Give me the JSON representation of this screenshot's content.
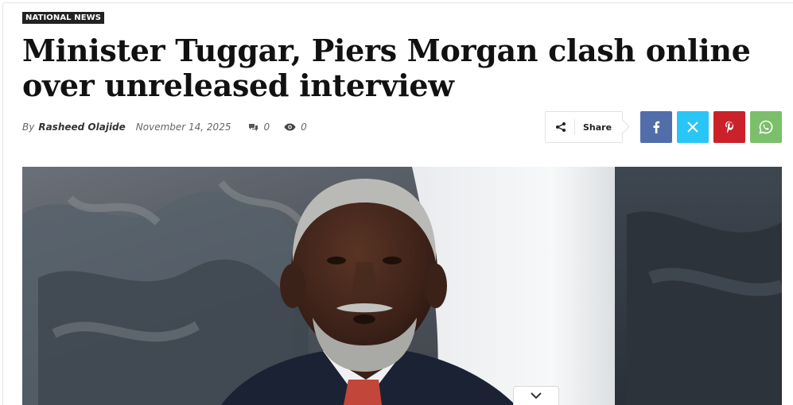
{
  "article": {
    "category": "NATIONAL NEWS",
    "headline": "Minister Tuggar, Piers Morgan clash online over unreleased interview",
    "byline_prefix": "By",
    "author": "Rasheed Olajide",
    "date": "November 14, 2025",
    "comments_count": "0",
    "views_count": "0"
  },
  "share": {
    "label": "Share",
    "buttons": [
      {
        "name": "facebook",
        "icon": "facebook-icon",
        "color": "#516eab"
      },
      {
        "name": "x",
        "icon": "x-icon",
        "color": "#29c5f6"
      },
      {
        "name": "pinterest",
        "icon": "pinterest-icon",
        "color": "#ca212a"
      },
      {
        "name": "whatsapp",
        "icon": "whatsapp-icon",
        "color": "#7bbf6a"
      }
    ]
  },
  "hero_image": {
    "subject": "portrait of a man with grey hair and beard in a dark suit"
  },
  "colors": {
    "tag_background": "#222222",
    "headline_text": "#111111"
  }
}
